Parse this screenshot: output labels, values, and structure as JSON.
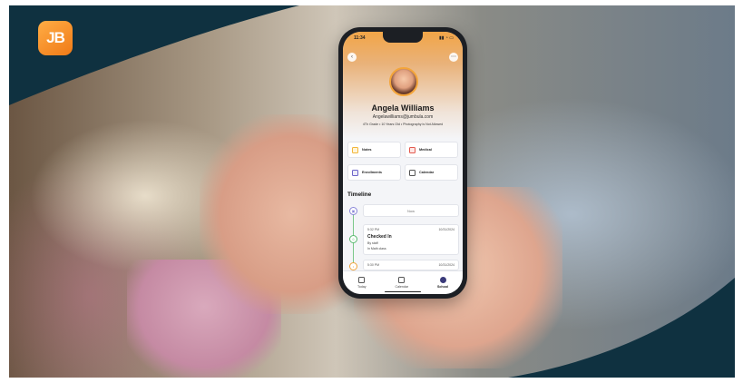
{
  "brand": {
    "logo_text": "JB"
  },
  "phone": {
    "status_time": "11:34",
    "status_icons": "▮▮ ◔ ▭",
    "profile": {
      "name": "Angela Williams",
      "email": "Angelawilliams@jumbula.com",
      "meta": "4Th Grade • 10 Years Old • Photography is Not Allowed"
    },
    "cards": [
      {
        "label": "Notes",
        "icon": "notes-icon",
        "color": "#f2b63a"
      },
      {
        "label": "Medical",
        "icon": "medical-icon",
        "color": "#e35a4f"
      },
      {
        "label": "Enrollments",
        "icon": "enrollments-icon",
        "color": "#6c64c9"
      },
      {
        "label": "Calendar",
        "icon": "calendar-icon",
        "color": "#555555"
      }
    ],
    "timeline": {
      "title": "Timeline",
      "now_label": "Now",
      "entries": [
        {
          "time": "5:32 PM",
          "date": "10/31/2024",
          "title": "Checked In",
          "by": "By staff",
          "location": "In Math class"
        },
        {
          "time": "5:30 PM",
          "date": "10/31/2024"
        }
      ]
    },
    "tabs": [
      {
        "label": "Today",
        "active": false
      },
      {
        "label": "Calendar",
        "active": false
      },
      {
        "label": "School",
        "active": true
      }
    ]
  },
  "colors": {
    "brand_dark": "#0f3140",
    "brand_orange": "#f07a17",
    "timeline_green": "#58b96e"
  }
}
